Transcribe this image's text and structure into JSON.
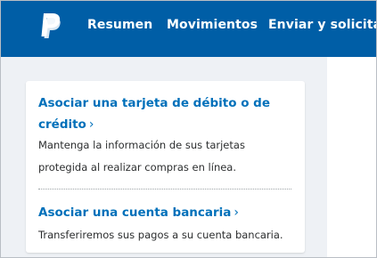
{
  "brand": {
    "logo_icon": "paypal-logo-icon",
    "bar_color": "#005ea6"
  },
  "nav": {
    "items": [
      {
        "label": "Resumen"
      },
      {
        "label": "Movimientos"
      },
      {
        "label": "Enviar y solicitar"
      }
    ]
  },
  "card": {
    "card_link": {
      "title": "Asociar una tarjeta de débito o de crédito",
      "chevron": "›",
      "description": "Mantenga la información de sus tarjetas protegida al realizar compras en línea."
    },
    "bank_link": {
      "title": "Asociar una cuenta bancaria",
      "chevron": "›",
      "description": "Transferiremos sus pagos a su cuenta bancaria."
    }
  },
  "colors": {
    "link": "#0070ba",
    "text": "#2c2e2f"
  }
}
